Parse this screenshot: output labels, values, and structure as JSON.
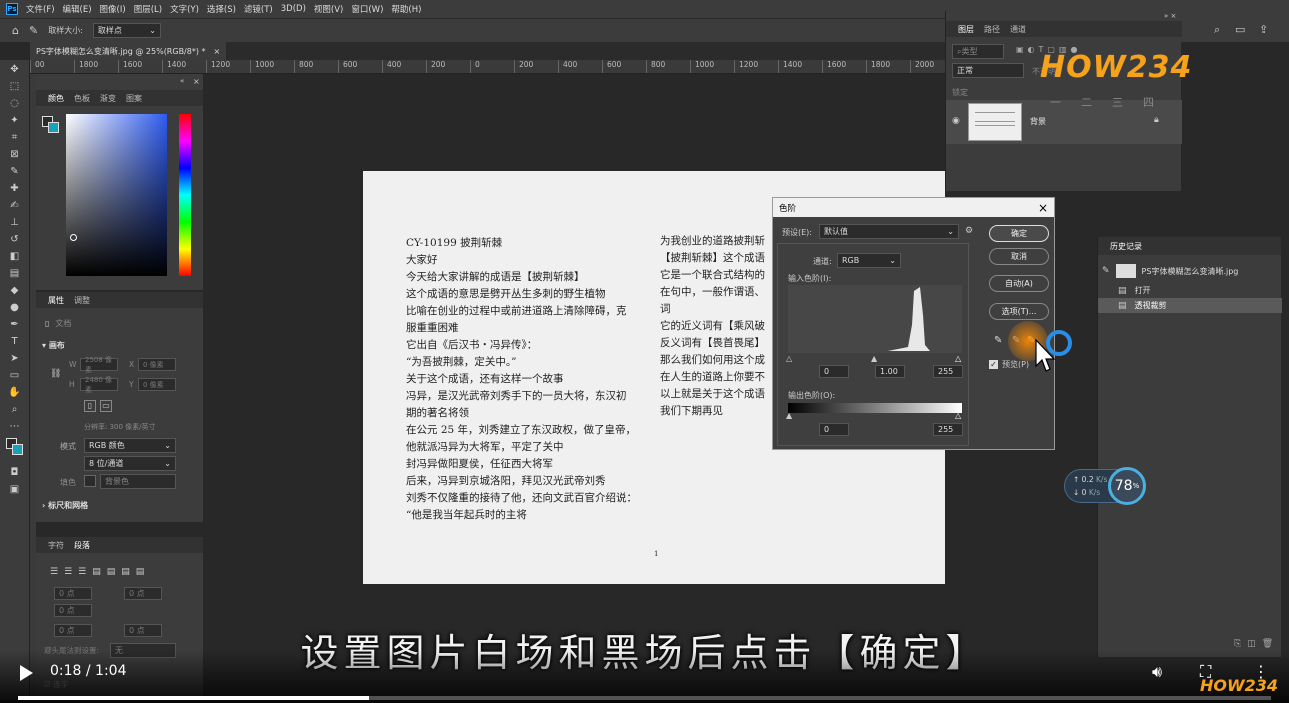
{
  "app": {
    "logo": "Ps",
    "menu": [
      "文件(F)",
      "编辑(E)",
      "图像(I)",
      "图层(L)",
      "文字(Y)",
      "选择(S)",
      "滤镜(T)",
      "3D(D)",
      "视图(V)",
      "窗口(W)",
      "帮助(H)"
    ]
  },
  "options_bar": {
    "sample_size_label": "取样大小:",
    "sample_size_value": "取样点"
  },
  "document_tab": {
    "title": "PS字体模糊怎么变清晰.jpg @ 25%(RGB/8*) *"
  },
  "ruler": {
    "ticks": [
      "00",
      "1800",
      "1600",
      "1400",
      "1200",
      "1000",
      "800",
      "600",
      "400",
      "200",
      "0",
      "200",
      "400",
      "600",
      "800",
      "1000",
      "1200",
      "1400",
      "1600",
      "1800",
      "2000",
      "2200",
      "2400",
      "2600",
      "2800",
      "3000",
      "3200",
      "3400"
    ]
  },
  "color_panel": {
    "tabs": [
      "颜色",
      "色板",
      "渐变",
      "图案"
    ]
  },
  "properties_panel": {
    "tabs": [
      "属性",
      "调整"
    ],
    "doc_label": "文档",
    "section_canvas": "画布",
    "w_label": "W",
    "w_value": "2508 像素",
    "h_label": "H",
    "h_value": "2480 像素",
    "x_label": "X",
    "x_value": "0 像素",
    "y_label": "Y",
    "y_value": "0 像素",
    "resolution": "分辨率: 300 像素/英寸",
    "mode_label": "模式",
    "mode_value": "RGB 颜色",
    "depth_value": "8 位/通道",
    "bg_label": "填色",
    "bg_value": "背景色",
    "section_rulers": "标尺和网格"
  },
  "char_panel": {
    "tabs": [
      "字符",
      "段落"
    ],
    "fields": [
      "0 点",
      "0 点",
      "0 点",
      "0 点",
      "0 点"
    ],
    "hyphen_label": "避头尾法则设置:",
    "hyphen_value": "无",
    "connect_label": "连字"
  },
  "document_text": {
    "left_lines": [
      "CY-10199 披荆斩棘",
      "大家好",
      "今天给大家讲解的成语是【披荆斩棘】",
      "这个成语的意思是劈开丛生多刺的野生植物",
      "比喻在创业的过程中或前进道路上清除障碍，克",
      "服重重困难",
      "它出自《后汉书・冯异传》：",
      "“为吾披荆棘，定关中。”",
      "关于这个成语，还有这样一个故事",
      "冯异，是汉光武帝刘秀手下的一员大将，东汉初",
      "期的著名将领",
      "在公元 25 年，刘秀建立了东汉政权，做了皇帝，",
      "他就派冯异为大将军，平定了关中",
      "封冯异做阳夏侯，任征西大将军",
      "后来，冯异到京城洛阳，拜见汉光武帝刘秀",
      "刘秀不仅隆重的接待了他，还向文武百官介绍说：",
      "“他是我当年起兵时的主将"
    ],
    "right_lines": [
      "为我创业的道路披荆斩",
      "【披荆斩棘】这个成语",
      "它是一个联合式结构的",
      "在句中，一般作谓语、",
      "词",
      "它的近义词有【乘风破",
      "反义词有【畏首畏尾】",
      "那么我们如何用这个成",
      "在人生的道路上你要不",
      "以上就是关于这个成语【披",
      "我们下期再见"
    ],
    "page_number": "1"
  },
  "levels_dialog": {
    "title": "色阶",
    "preset_label": "预设(E):",
    "preset_value": "默认值",
    "channel_label": "通道:",
    "channel_value": "RGB",
    "input_label": "输入色阶(I):",
    "input_black": "0",
    "input_gamma": "1.00",
    "input_white": "255",
    "output_label": "输出色阶(O):",
    "output_black": "0",
    "output_white": "255",
    "ok": "确定",
    "cancel": "取消",
    "auto": "自动(A)",
    "options": "选项(T)...",
    "preview": "预览(P)"
  },
  "layers_panel": {
    "tabs": [
      "图层",
      "路径",
      "通道"
    ],
    "search_placeholder": "类型",
    "blend_mode": "正常",
    "opacity_label": "不透明",
    "lock_label": "锁定",
    "layer_name": "背景"
  },
  "history_panel": {
    "tab": "历史记录",
    "snapshot": "PS字体模糊怎么变清晰.jpg",
    "items": [
      "打开",
      "透视裁剪"
    ]
  },
  "network_widget": {
    "up": "0.2",
    "down": "0",
    "unit": "K/s",
    "percent": "78",
    "percent_unit": "%"
  },
  "subtitle": "设置图片白场和黑场后点击【确定】",
  "video": {
    "time": "0:18 / 1:04",
    "progress": 0.28
  },
  "watermark": {
    "text": "HOW234",
    "chars": [
      "一",
      "二",
      "三",
      "四"
    ]
  },
  "colors": {
    "accent": "#31a8ff",
    "watermark_orange": "#f7a21b",
    "watermark_blue": "#2a7de1"
  }
}
